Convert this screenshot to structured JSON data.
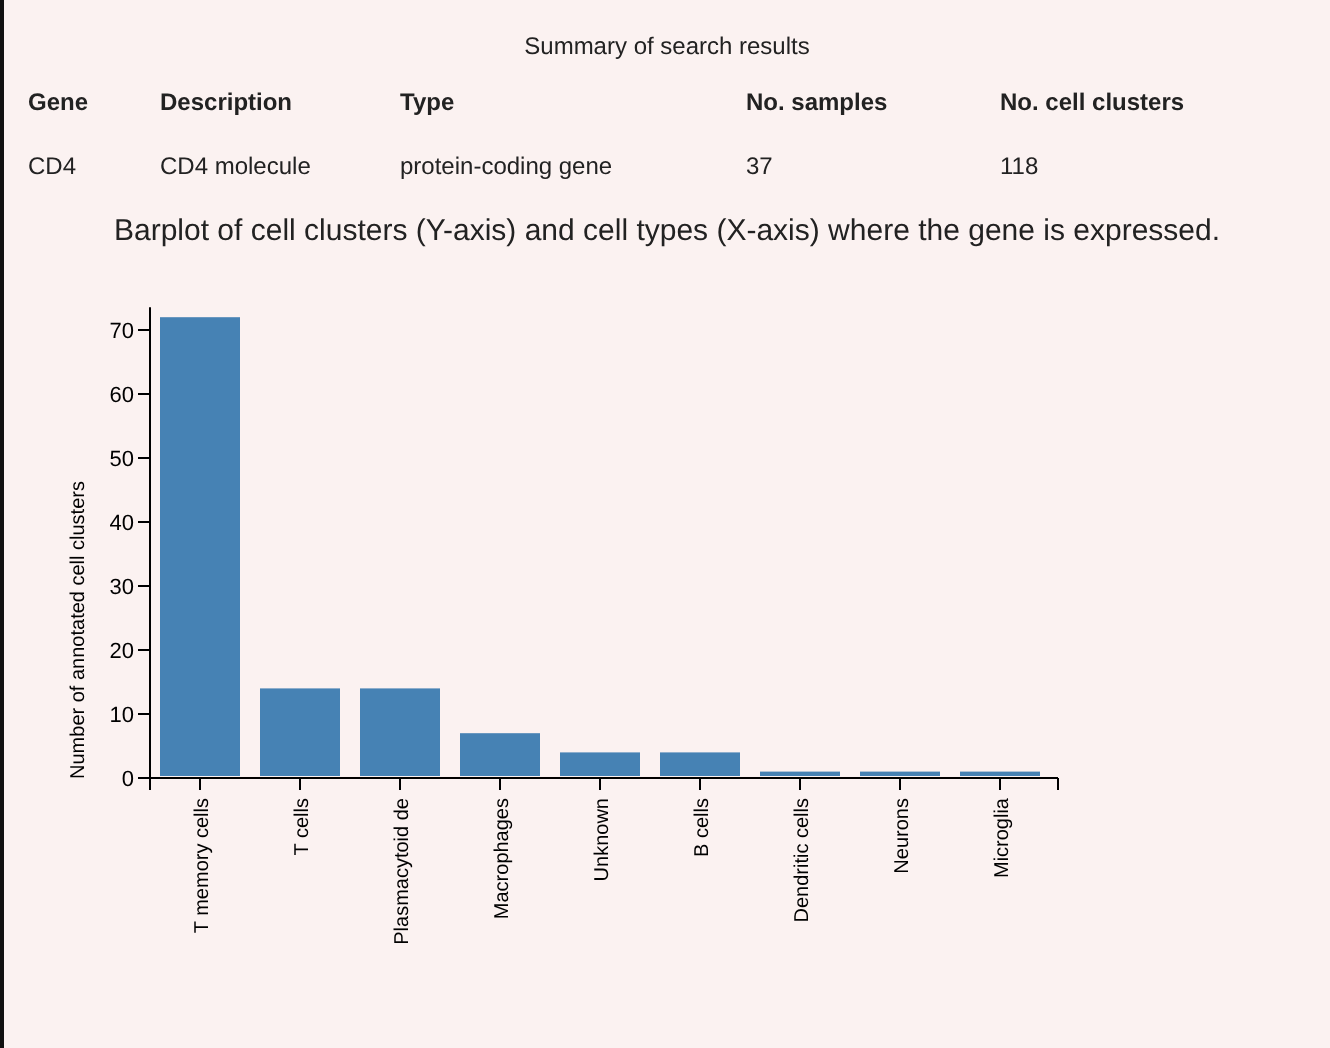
{
  "summary_title": "Summary of search results",
  "table": {
    "columns": [
      "Gene",
      "Description",
      "Type",
      "No. samples",
      "No. cell clusters"
    ],
    "rows": [
      [
        "CD4",
        "CD4 molecule",
        "protein-coding gene",
        "37",
        "118"
      ]
    ]
  },
  "caption": "Barplot of cell clusters (Y-axis) and cell types (X-axis) where the gene is expressed.",
  "chart_data": {
    "type": "bar",
    "ylabel": "Number of annotated cell clusters",
    "categories": [
      "T memory cells",
      "T cells",
      "Plasmacytoid de",
      "Macrophages",
      "Unknown",
      "B cells",
      "Dendritic cells",
      "Neurons",
      "Microglia"
    ],
    "series": [
      {
        "color": "#4682b4",
        "values": [
          72,
          14,
          14,
          7,
          4,
          4,
          1,
          1,
          1
        ]
      }
    ],
    "ylim": [
      0,
      72
    ],
    "yticks": [
      0,
      10,
      20,
      30,
      40,
      50,
      60,
      70
    ]
  }
}
